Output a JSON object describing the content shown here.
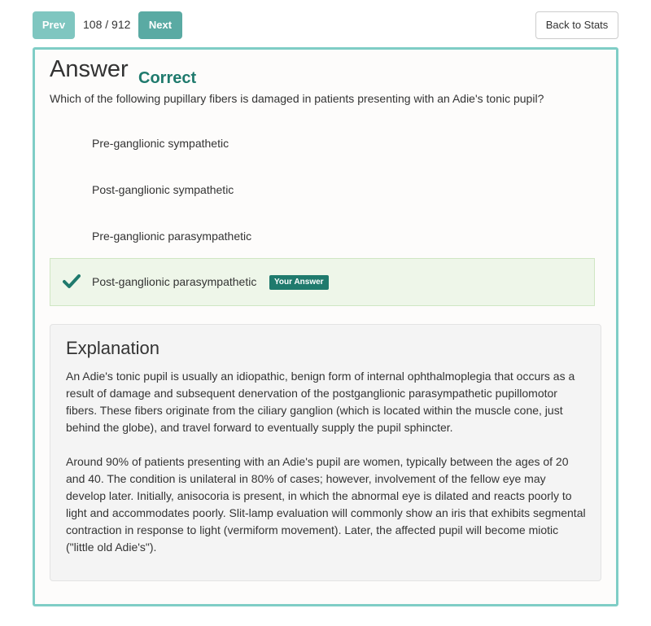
{
  "nav": {
    "prev_label": "Prev",
    "counter": "108 / 912",
    "next_label": "Next",
    "back_label": "Back to Stats"
  },
  "answer": {
    "heading": "Answer",
    "result": "Correct",
    "question": "Which of the following pupillary fibers is damaged in patients presenting with an Adie's tonic pupil?",
    "options": [
      {
        "label": "Pre-ganglionic sympathetic"
      },
      {
        "label": "Post-ganglionic sympathetic"
      },
      {
        "label": "Pre-ganglionic parasympathetic"
      },
      {
        "label": "Post-ganglionic parasympathetic",
        "selected": true,
        "badge": "Your Answer"
      }
    ]
  },
  "explanation": {
    "title": "Explanation",
    "paragraphs": [
      "An Adie's tonic pupil is usually an idiopathic, benign form of internal ophthalmoplegia that occurs as a result of damage and subsequent denervation of the postganglionic parasympathetic pupillomotor fibers. These fibers originate from the ciliary ganglion (which is located within the muscle cone, just behind the globe), and travel forward to eventually supply the pupil sphincter.",
      "Around 90% of patients presenting with an Adie's pupil are women, typically between the ages of 20 and 40. The condition is unilateral in 80% of cases; however, involvement of the fellow eye may develop later. Initially, anisocoria is present, in which the abnormal eye is dilated and reacts poorly to light and accommodates poorly. Slit-lamp evaluation will commonly show an iris that exhibits segmental contraction in response to light (vermiform movement). Later, the affected pupil will become miotic (\"little old Adie's\")."
    ]
  },
  "colors": {
    "accent": "#5aaaa3",
    "accent_light": "#7fc6c0",
    "correct": "#1f7a6d",
    "card_border": "#7fcdc6",
    "selected_bg": "#eef6e9"
  },
  "icons": {
    "check": "checkmark-icon"
  }
}
